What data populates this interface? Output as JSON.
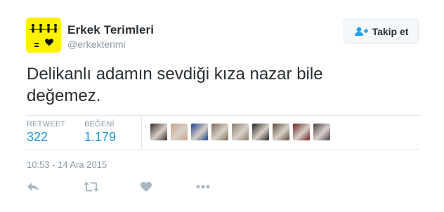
{
  "account": {
    "name": "Erkek Terimleri",
    "handle": "@erkekterimi",
    "avatar_bg": "#fff200"
  },
  "follow_button": {
    "label": "Takip et",
    "icon": "follow-person-plus-icon"
  },
  "tweet": {
    "text_line1": "Delikanlı adamın sevdiği kıza nazar bile",
    "text_line2": "değemez."
  },
  "stats": {
    "retweet_label": "RETWEET",
    "retweet_count": "322",
    "like_label": "BEĞENİ",
    "like_count": "1.179"
  },
  "likers": [
    {
      "color": "#3a2a2a"
    },
    {
      "color": "#c9a38c"
    },
    {
      "color": "#1d3f8a"
    },
    {
      "color": "#7a6a55"
    },
    {
      "color": "#8a7b6e"
    },
    {
      "color": "#222222"
    },
    {
      "color": "#5a4a3a"
    },
    {
      "color": "#6b1e1e"
    },
    {
      "color": "#4a3a4a"
    }
  ],
  "timestamp": "10:53 - 14 Ara 2015",
  "actions": [
    {
      "name": "reply-icon"
    },
    {
      "name": "retweet-icon"
    },
    {
      "name": "like-heart-icon"
    },
    {
      "name": "more-dots-icon"
    }
  ],
  "colors": {
    "link_blue": "#1b95e0",
    "muted": "#8899a6",
    "text": "#292f33",
    "border": "#e1e8ed",
    "icon_gray": "#aab8c2"
  }
}
